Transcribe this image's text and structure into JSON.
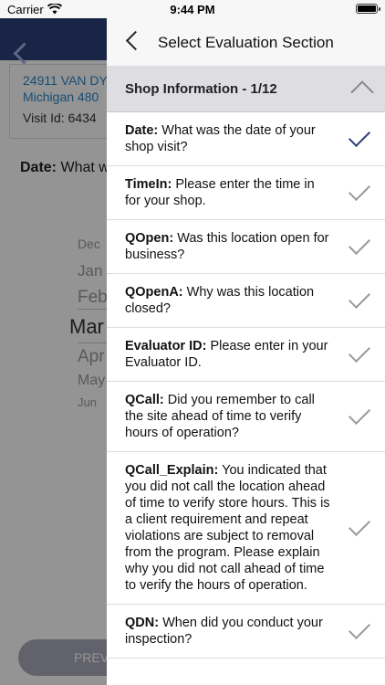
{
  "status_bar": {
    "carrier": "Carrier",
    "time": "9:44 PM"
  },
  "background": {
    "address_line1": "24911 VAN DY",
    "address_line2": "Michigan 480",
    "visit_id": "Visit Id: 6434",
    "question_label": "Date:",
    "question_text": "What w",
    "picker_months": [
      "Dec",
      "Jan",
      "Feb",
      "Mar",
      "Apr",
      "May",
      "Jun"
    ],
    "prev_button": "PREV"
  },
  "panel": {
    "title": "Select Evaluation Section",
    "section_title": "Shop Information - 1/12",
    "items": [
      {
        "label": "Date:",
        "text": "What was the date of your shop visit?",
        "checked": true
      },
      {
        "label": "TimeIn:",
        "text": "Please enter the time in for your shop.",
        "checked": false
      },
      {
        "label": "QOpen:",
        "text": "Was this location open for business?",
        "checked": false
      },
      {
        "label": "QOpenA:",
        "text": "Why was this location closed?",
        "checked": false
      },
      {
        "label": "Evaluator ID:",
        "text": "Please enter in your Evaluator ID.",
        "checked": false
      },
      {
        "label": "QCall:",
        "text": "Did you remember to call the site ahead of time to verify hours of operation?",
        "checked": false
      },
      {
        "label": "QCall_Explain:",
        "text": "You indicated that you did not call the location ahead of time to verify store hours. This is a client requirement and repeat violations are subject to removal from the program. Please explain why you did not call ahead of time to verify the hours of operation.",
        "checked": false
      },
      {
        "label": "QDN:",
        "text": "When did you conduct your inspection?",
        "checked": false
      }
    ]
  }
}
